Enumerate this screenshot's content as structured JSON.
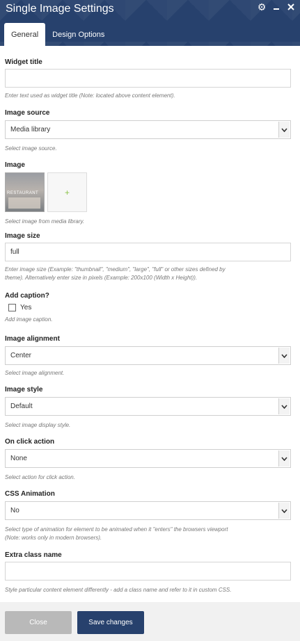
{
  "window": {
    "title": "Single Image Settings",
    "icons": [
      "gear-icon",
      "minimize-icon",
      "close-icon"
    ]
  },
  "tabs": [
    {
      "label": "General",
      "active": true
    },
    {
      "label": "Design Options",
      "active": false
    }
  ],
  "fields": {
    "widget_title": {
      "label": "Widget title",
      "value": "",
      "help": "Enter text used as widget title (Note: located above content element)."
    },
    "image_source": {
      "label": "Image source",
      "selected": "Media library",
      "help": "Select image source."
    },
    "image": {
      "label": "Image",
      "thumbnail_text": "RESTAURANT",
      "add_label": "+",
      "help": "Select image from media library."
    },
    "image_size": {
      "label": "Image size",
      "value": "full",
      "help_line1": "Enter image size (Example: \"thumbnail\", \"medium\", \"large\", \"full\" or other sizes defined by",
      "help_line2": "theme). Alternatively enter size in pixels (Example: 200x100 (Width x Height))."
    },
    "add_caption": {
      "label": "Add caption?",
      "checkbox_label": "Yes",
      "checked": false,
      "help": "Add image caption."
    },
    "image_alignment": {
      "label": "Image alignment",
      "selected": "Center",
      "help": "Select image alignment."
    },
    "image_style": {
      "label": "Image style",
      "selected": "Default",
      "help": "Select image display style."
    },
    "on_click_action": {
      "label": "On click action",
      "selected": "None",
      "help": "Select action for click action."
    },
    "css_animation": {
      "label": "CSS Animation",
      "selected": "No",
      "help_line1": "Select type of animation for element to be animated when it \"enters\" the browsers viewport",
      "help_line2": "(Note: works only in modern browsers)."
    },
    "extra_class": {
      "label": "Extra class name",
      "value": "",
      "help": "Style particular content element differently - add a class name and refer to it in custom CSS."
    }
  },
  "footer": {
    "close_label": "Close",
    "save_label": "Save changes"
  },
  "colors": {
    "header": "#27416d",
    "save_button": "#27416d",
    "close_button": "#b9b9b9",
    "add_plus": "#8bc34a"
  }
}
